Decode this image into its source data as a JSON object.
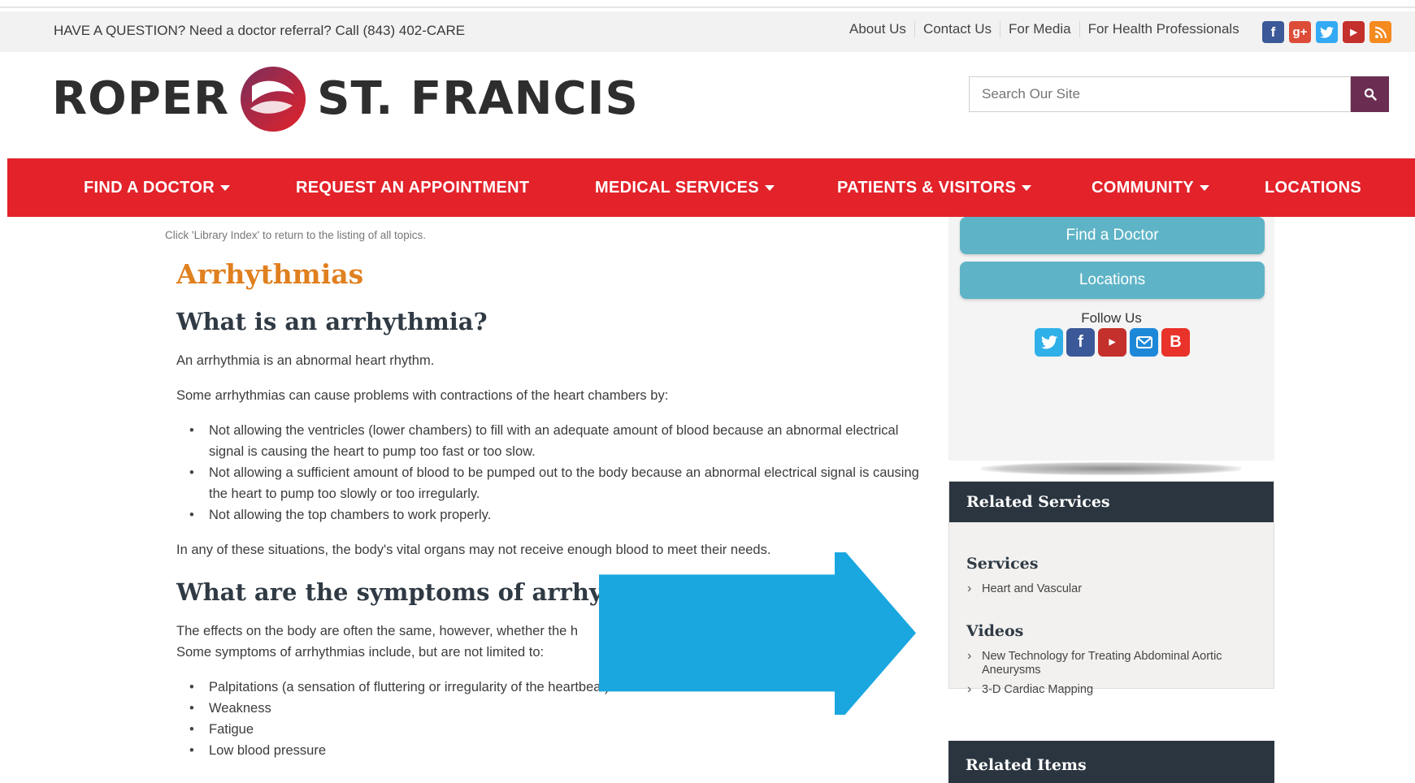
{
  "utility": {
    "question": "HAVE A QUESTION? Need a doctor referral? Call (843) 402-CARE",
    "links": [
      "About Us",
      "Contact Us",
      "For Media",
      "For Health Professionals"
    ],
    "social": [
      "facebook-icon",
      "google-plus-icon",
      "twitter-icon",
      "youtube-icon",
      "rss-icon"
    ]
  },
  "brand": {
    "left": "ROPER",
    "right": "ST. FRANCIS",
    "accent": "#e3222a",
    "plum": "#6b2d52"
  },
  "search": {
    "placeholder": "Search Our Site"
  },
  "nav": {
    "items": [
      "FIND A DOCTOR",
      "REQUEST AN APPOINTMENT",
      "MEDICAL SERVICES",
      "PATIENTS & VISITORS",
      "COMMUNITY",
      "LOCATIONS"
    ]
  },
  "article": {
    "note": "Click 'Library Index' to return to the listing of all topics.",
    "title": "Arrhythmias",
    "h_what": "What is an arrhythmia?",
    "p1": "An arrhythmia is an abnormal heart rhythm.",
    "p2": "Some arrhythmias can cause problems with contractions of the heart chambers by:",
    "bullets1": [
      "Not allowing the ventricles (lower chambers) to fill with an adequate amount of blood because an abnormal electrical signal is causing the heart to pump too fast or too slow.",
      "Not allowing a sufficient amount of blood to be pumped out to the body because an abnormal electrical signal is causing the heart to pump too slowly or too irregularly.",
      "Not allowing the top chambers to work properly."
    ],
    "p3": "In any of these situations, the body's vital organs may not receive enough blood to meet their needs.",
    "h_symptoms": "What are the symptoms of arrhythm",
    "p4": "The effects on the body are often the same, however, whether the h",
    "p5": "Some symptoms of arrhythmias include, but are not limited to:",
    "bullets2": [
      "Palpitations (a sensation of fluttering or irregularity of the heartbeat)",
      "Weakness",
      "Fatigue",
      "Low blood pressure"
    ]
  },
  "sidebar": {
    "btn_find": "Find a Doctor",
    "btn_locations": "Locations",
    "follow": "Follow Us",
    "follow_icons": [
      "twitter-icon",
      "facebook-icon",
      "youtube-icon",
      "email-icon",
      "blogger-icon"
    ],
    "related_services": "Related Services",
    "services_title": "Services",
    "services": [
      "Heart and Vascular"
    ],
    "videos_title": "Videos",
    "videos": [
      "New Technology for Treating Abdominal Aortic Aneurysms",
      "3-D Cardiac Mapping"
    ],
    "related_items": "Related Items"
  },
  "overlay": {
    "arrow_color": "#1aa7e0"
  }
}
